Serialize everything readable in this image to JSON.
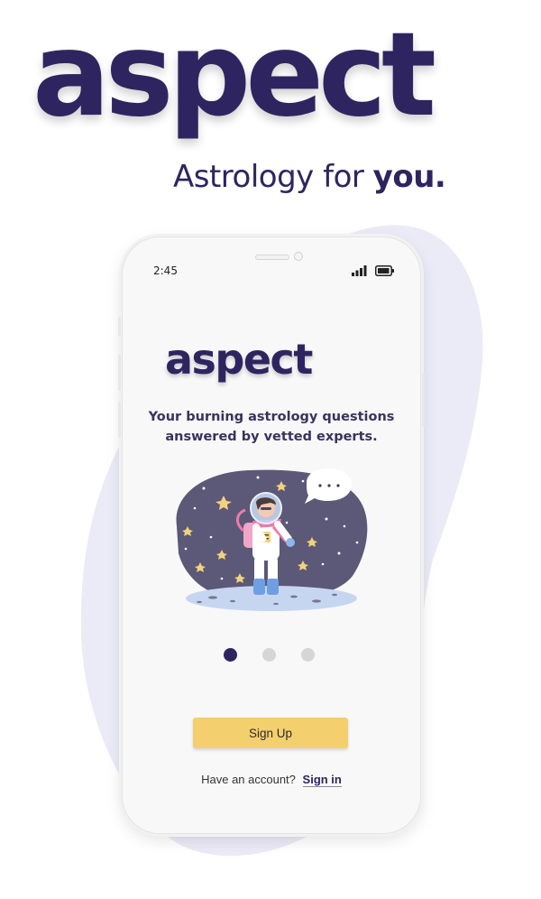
{
  "brand": {
    "logo_text": "aspect",
    "tagline_prefix": "Astrology for",
    "tagline_emphasis": "you."
  },
  "status_bar": {
    "time": "2:45",
    "icons": [
      "signal-icon",
      "battery-icon"
    ]
  },
  "screen": {
    "logo_text": "aspect",
    "subtitle": "Your burning astrology questions answered by vetted experts.",
    "pagination": {
      "total": 3,
      "active_index": 0
    },
    "signup_label": "Sign Up",
    "account_prompt": "Have an account?",
    "signin_label": "Sign in"
  },
  "colors": {
    "brand_primary": "#2e2560",
    "button_yellow": "#f4cf6e",
    "blob_lavender": "#ebeaf7",
    "illustration_bg": "#5b5878"
  }
}
